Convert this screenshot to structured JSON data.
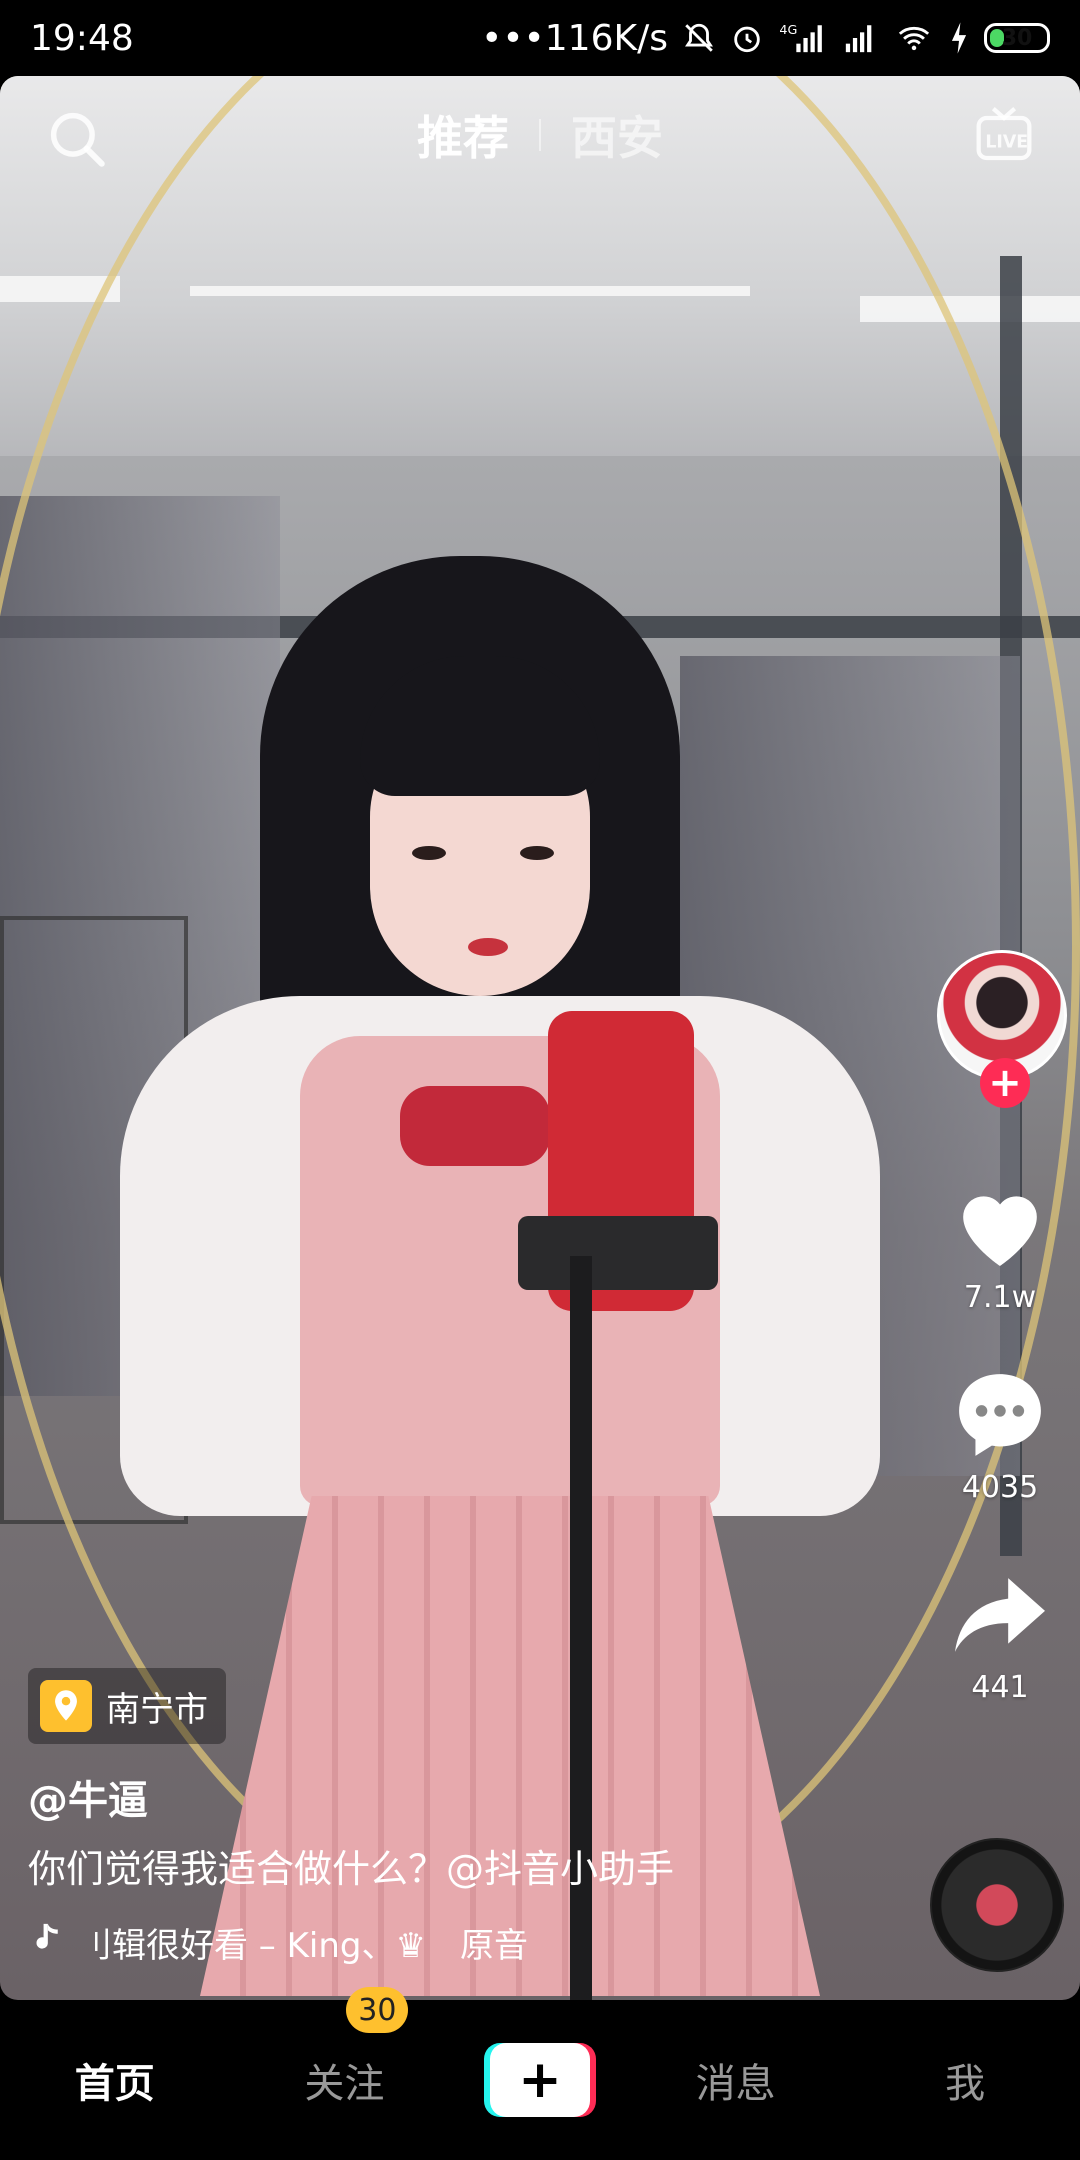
{
  "status_bar": {
    "time": "19:48",
    "network_speed": "•••116K/s",
    "battery": "30",
    "icons": [
      "mute-bell-icon",
      "alarm-icon",
      "4g-signal-icon",
      "signal-icon",
      "wifi-icon",
      "charging-icon",
      "battery-icon"
    ]
  },
  "top_nav": {
    "tabs": [
      {
        "label": "推荐",
        "active": true
      },
      {
        "label": "西安",
        "active": false
      }
    ],
    "icons": [
      "search-icon",
      "live-tv-icon"
    ]
  },
  "side_actions": {
    "likes": "7.1w",
    "comments": "4035",
    "shares": "441",
    "follow_symbol": "+"
  },
  "post": {
    "location": "南宁市",
    "username": "@牛逼",
    "caption": "你们觉得我适合做什么？@抖音小助手",
    "music": "刂辑很好看 – King、♛　原音"
  },
  "bottom_nav": {
    "items": [
      {
        "label": "首页",
        "active": true
      },
      {
        "label": "关注",
        "badge": "30"
      },
      {
        "label": "+",
        "type": "create"
      },
      {
        "label": "消息"
      },
      {
        "label": "我"
      }
    ]
  },
  "colors": {
    "accent_red": "#fe2c55",
    "accent_cyan": "#25f4ee",
    "badge_yellow": "#fec02e",
    "battery_green": "#4cd964"
  }
}
